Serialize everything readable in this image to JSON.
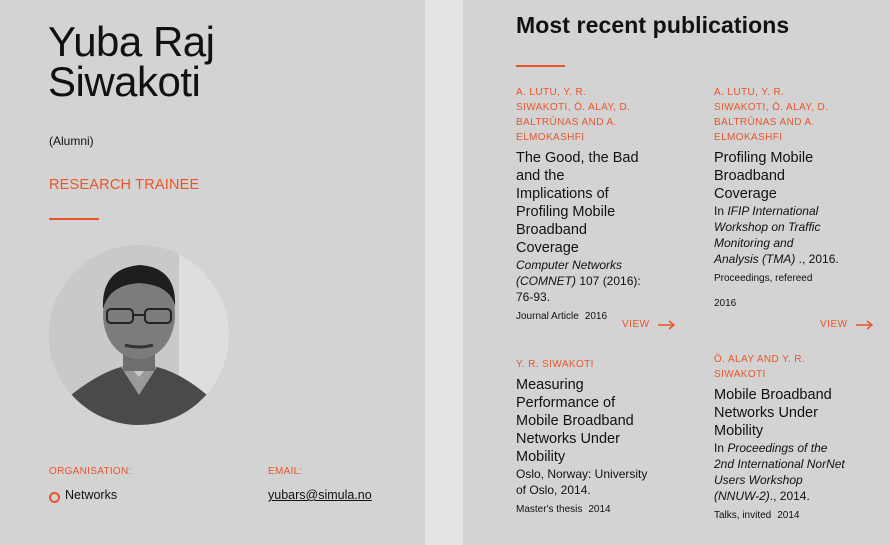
{
  "profile": {
    "name_line1": "Yuba Raj",
    "name_line2": "Siwakoti",
    "status": "(Alumni)",
    "role": "RESEARCH TRAINEE",
    "organisation_label": "ORGANISATION:",
    "organisation": "Networks",
    "email_label": "EMAIL:",
    "email": "yubars@simula.no"
  },
  "publications": {
    "heading": "Most recent publications",
    "view_label": "VIEW",
    "items": [
      {
        "authors": "A. LUTU, Y. R. SIWAKOTI, Ö. ALAY, D. BALTRŪNAS AND A. ELMOKASHFI",
        "title": "The Good, the Bad and the Implications of Profiling Mobile Broadband Coverage",
        "venue_italic": "Computer Networks (COMNET)",
        "venue_rest": " 107 (2016): 76-93.",
        "type": "Journal Article",
        "year": "2016"
      },
      {
        "authors": "A. LUTU, Y. R. SIWAKOTI, Ö. ALAY, D. BALTRŪNAS AND A. ELMOKASHFI",
        "title": "Profiling Mobile Broadband Coverage",
        "venue_prefix": "In ",
        "venue_italic": "IFIP International Workshop on Traffic Monitoring and Analysis (TMA)",
        "venue_rest": " ., 2016.",
        "type": "Proceedings, refereed",
        "year": "2016"
      },
      {
        "authors": "Y. R. SIWAKOTI",
        "title": "Measuring Performance of Mobile Broadband Networks Under Mobility",
        "venue_rest": "Oslo, Norway: University of Oslo, 2014.",
        "type": "Master's thesis",
        "year": "2014"
      },
      {
        "authors": "Ö. ALAY AND Y. R. SIWAKOTI",
        "title": "Mobile Broadband Networks Under Mobility",
        "venue_prefix": "In ",
        "venue_italic": "Proceedings of the 2nd International NorNet Users Workshop (NNUW-2)",
        "venue_rest": "., 2014.",
        "type": "Talks, invited",
        "year": "2014"
      }
    ]
  },
  "colors": {
    "accent": "#e8552b",
    "background": "#d3d3d3",
    "divider": "#e3e3e3"
  }
}
